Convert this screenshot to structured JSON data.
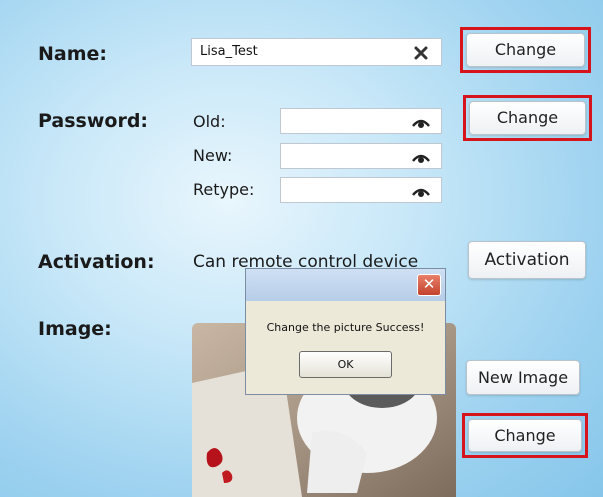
{
  "name": {
    "label": "Name:",
    "value": "Lisa_Test",
    "change_label": "Change"
  },
  "password": {
    "label": "Password:",
    "old_label": "Old:",
    "new_label": "New:",
    "retype_label": "Retype:",
    "change_label": "Change"
  },
  "activation": {
    "label": "Activation:",
    "status_text": "Can remote control device",
    "button_label": "Activation"
  },
  "image": {
    "label": "Image:",
    "new_image_label": "New Image",
    "change_label": "Change"
  },
  "dialog": {
    "close_glyph": "✕",
    "message": "Change the picture Success!",
    "ok_label": "OK"
  },
  "colors": {
    "highlight": "#d5141c",
    "background": "#b4dcf4"
  },
  "icons": {
    "clear": "close-icon",
    "reveal": "eye-icon"
  }
}
